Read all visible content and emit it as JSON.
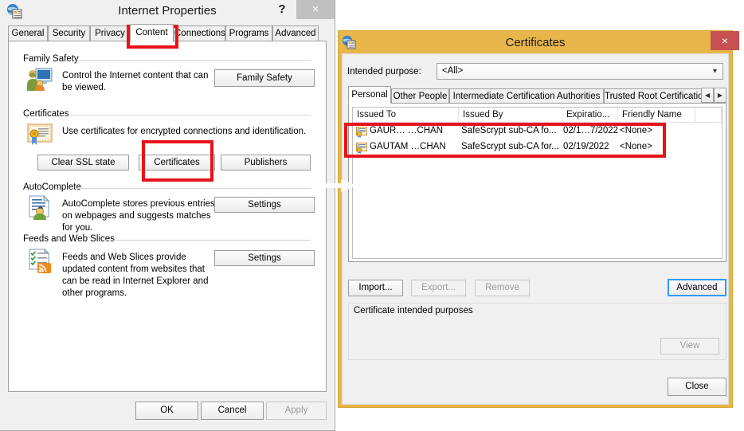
{
  "ie_window": {
    "title": "Internet Properties",
    "app_icon": "internet-properties-icon",
    "help_label": "?",
    "close_label": "×",
    "tabs": [
      {
        "label": "General",
        "active": false
      },
      {
        "label": "Security",
        "active": false
      },
      {
        "label": "Privacy",
        "active": false
      },
      {
        "label": "Content",
        "active": true
      },
      {
        "label": "Connections",
        "active": false
      },
      {
        "label": "Programs",
        "active": false
      },
      {
        "label": "Advanced",
        "active": false
      }
    ],
    "groups": {
      "family_safety": {
        "label": "Family Safety",
        "description": "Control the Internet content that can be viewed.",
        "button": "Family Safety",
        "icon": "family-safety-icon"
      },
      "certificates": {
        "label": "Certificates",
        "description": "Use certificates for encrypted connections and identification.",
        "icon": "certificate-icon",
        "buttons": [
          "Clear SSL state",
          "Certificates",
          "Publishers"
        ]
      },
      "autocomplete": {
        "label": "AutoComplete",
        "description": "AutoComplete stores previous entries on webpages and suggests matches for you.",
        "button": "Settings",
        "icon": "autocomplete-icon"
      },
      "feeds": {
        "label": "Feeds and Web Slices",
        "description": "Feeds and Web Slices provide updated content from websites that can be read in Internet Explorer and other programs.",
        "button": "Settings",
        "icon": "feeds-icon"
      }
    },
    "footer_buttons": [
      {
        "label": "OK",
        "disabled": false
      },
      {
        "label": "Cancel",
        "disabled": false
      },
      {
        "label": "Apply",
        "disabled": true
      }
    ]
  },
  "cert_window": {
    "title": "Certificates",
    "app_icon": "certificates-app-icon",
    "close_label": "×",
    "intended_purpose": {
      "label": "Intended purpose:",
      "value": "<All>",
      "arrow": "chevron-down-icon"
    },
    "tabs": [
      {
        "label": "Personal",
        "active": true
      },
      {
        "label": "Other People",
        "active": false
      },
      {
        "label": "Intermediate Certification Authorities",
        "active": false
      },
      {
        "label": "Trusted Root Certification",
        "active": false
      }
    ],
    "tab_scroll": {
      "left": "◀",
      "right": "▶"
    },
    "list": {
      "columns": [
        "Issued To",
        "Issued By",
        "Expiratio...",
        "Friendly Name"
      ],
      "rows": [
        {
          "icon": "certificate-row-icon",
          "issued_to": "GAUR… …CHAN",
          "issued_by": "SafeScrypt sub-CA fo...",
          "expiration": "02/1…7/2022",
          "friendly_name": "<None>"
        },
        {
          "icon": "certificate-row-icon",
          "issued_to": "GAUTAM   …CHAN",
          "issued_by": "SafeScrypt sub-CA for...",
          "expiration": "02/19/2022",
          "friendly_name": "<None>"
        }
      ]
    },
    "action_buttons": [
      {
        "label": "Import...",
        "disabled": false,
        "focused": false
      },
      {
        "label": "Export...",
        "disabled": true,
        "focused": false
      },
      {
        "label": "Remove",
        "disabled": true,
        "focused": false
      },
      {
        "label": "Advanced",
        "disabled": false,
        "focused": true
      }
    ],
    "intended_purposes_group": {
      "label": "Certificate intended purposes",
      "view_button": {
        "label": "View",
        "disabled": true
      }
    },
    "close_button": {
      "label": "Close"
    }
  },
  "annotations": {
    "accent_red": "#e8131a",
    "boxes": [
      {
        "name": "content-tab-highlight"
      },
      {
        "name": "certificates-button-highlight"
      },
      {
        "name": "certificate-row-highlight"
      }
    ],
    "arrow": {
      "name": "pointer-arrow",
      "color": "#ffffff"
    }
  },
  "colors": {
    "cert_title_bar": "#e8b64a",
    "cert_close": "#c75050",
    "focus_blue": "#3399ff"
  }
}
